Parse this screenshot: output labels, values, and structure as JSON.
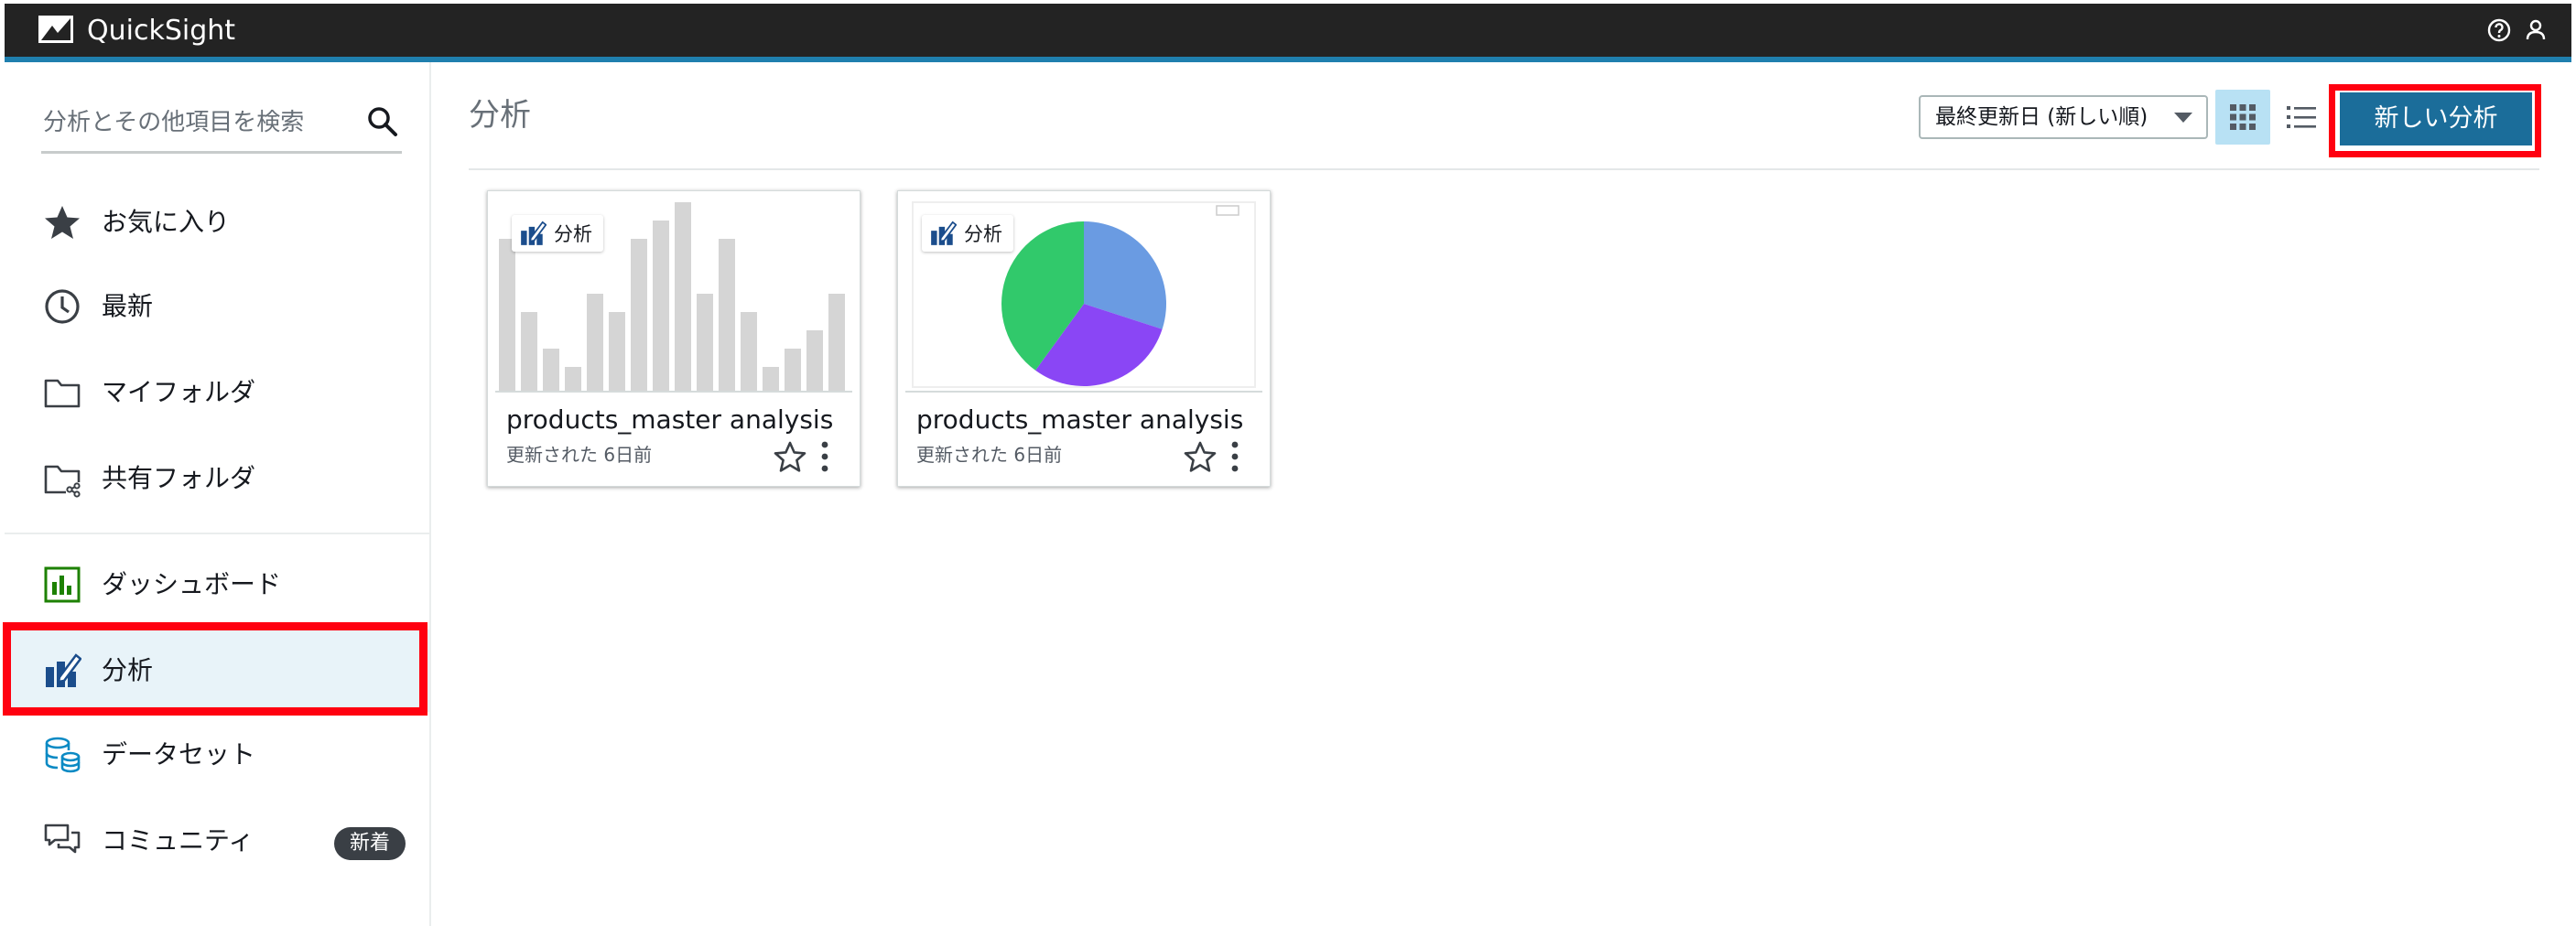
{
  "app": {
    "title": "QuickSight"
  },
  "search": {
    "placeholder": "分析とその他項目を検索"
  },
  "sidebar": {
    "items": [
      {
        "label": "お気に入り",
        "icon": "star-icon"
      },
      {
        "label": "最新",
        "icon": "clock-icon"
      },
      {
        "label": "マイフォルダ",
        "icon": "folder-icon"
      },
      {
        "label": "共有フォルダ",
        "icon": "shared-folder-icon"
      },
      {
        "label": "ダッシュボード",
        "icon": "dashboard-icon"
      },
      {
        "label": "分析",
        "icon": "analysis-icon",
        "active": true
      },
      {
        "label": "データセット",
        "icon": "dataset-icon"
      },
      {
        "label": "コミュニティ",
        "icon": "community-icon",
        "badge": "新着"
      }
    ]
  },
  "main": {
    "title": "分析",
    "sort": {
      "selected": "最終更新日 (新しい順)"
    },
    "new_button": "新しい分析",
    "cards": [
      {
        "tag": "分析",
        "title": "products_master analysis",
        "meta": "更新された 6日前",
        "thumbnail": "bar-chart"
      },
      {
        "tag": "分析",
        "title": "products_master analysis",
        "meta": "更新された 6日前",
        "thumbnail": "pie-chart"
      }
    ]
  },
  "colors": {
    "topbar": "#232323",
    "accent": "#1f7fae",
    "primary_button": "#1b6d9a",
    "active_bg": "#e8f3f9",
    "highlight": "#ff0010",
    "pie_blue": "#6a9be2",
    "pie_purple": "#8a46f5",
    "pie_green": "#31c96b"
  }
}
